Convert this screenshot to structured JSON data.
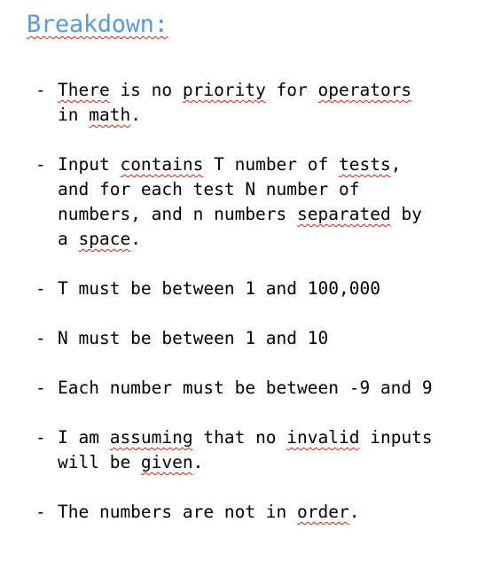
{
  "heading": "Breakdown:",
  "bullet_char": "-",
  "items": [
    [
      {
        "t": "There",
        "sq": true
      },
      {
        "t": " is no "
      },
      {
        "t": "priority",
        "sq": true
      },
      {
        "t": " for "
      },
      {
        "t": "operators",
        "sq": true
      },
      {
        "t": "\nin "
      },
      {
        "t": "math",
        "sq": true
      },
      {
        "t": "."
      }
    ],
    [
      {
        "t": "Input "
      },
      {
        "t": "contains",
        "sq": true
      },
      {
        "t": " T number of "
      },
      {
        "t": "tests",
        "sq": true
      },
      {
        "t": ","
      },
      {
        "t": "\nand for each test N number of\nnumbers, and n numbers "
      },
      {
        "t": "separated",
        "sq": true
      },
      {
        "t": " by\na "
      },
      {
        "t": "space",
        "sq": true
      },
      {
        "t": "."
      }
    ],
    [
      {
        "t": "T must be between 1 and 100,000"
      }
    ],
    [
      {
        "t": "N must be between 1 and 10"
      }
    ],
    [
      {
        "t": "Each number must be between -9 and 9"
      }
    ],
    [
      {
        "t": "I am "
      },
      {
        "t": "assuming",
        "sq": true
      },
      {
        "t": " that no "
      },
      {
        "t": "invalid",
        "sq": true
      },
      {
        "t": " inputs"
      },
      {
        "t": "\nwill be "
      },
      {
        "t": "given",
        "sq": true
      },
      {
        "t": "."
      }
    ],
    [
      {
        "t": "The numbers are not in "
      },
      {
        "t": "order",
        "sq": true
      },
      {
        "t": "."
      }
    ]
  ]
}
